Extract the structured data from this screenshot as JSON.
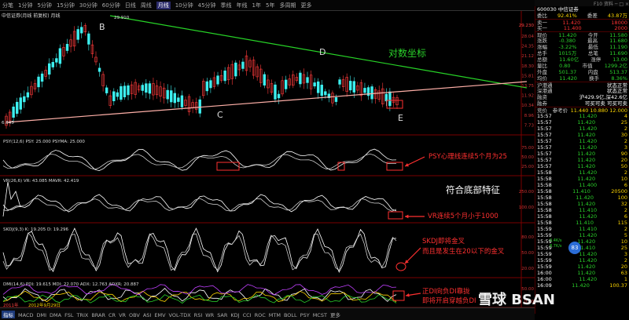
{
  "toolbar": {
    "period_tabs": [
      "分笔",
      "1分钟",
      "5分钟",
      "15分钟",
      "30分钟",
      "60分钟",
      "日线",
      "周线",
      "月线",
      "10分钟",
      "45分钟",
      "季线",
      "年线",
      "1年",
      "5年",
      "多周期",
      "更多"
    ],
    "active_tab": "月线"
  },
  "titlebar": {
    "text": "F10  资料  ─ □ ×"
  },
  "chart": {
    "title": "中信证券(月线 前复权) 月线",
    "high_label": "29.910",
    "low_label": "6.645",
    "right_top_price": "29.230",
    "y_labels": [
      "28.04",
      "24.35",
      "21.12",
      "18.30",
      "15.81",
      "13.75",
      "11.92",
      "10.34",
      "8.96",
      "7.73"
    ],
    "overlay_text": "对数坐标",
    "point_labels": {
      "B": "B",
      "C": "C",
      "D": "D",
      "E": "E"
    },
    "psy_label": "PSY(12,6) PSY: 25.000  PSYMA: 25.000",
    "psy_y": [
      "75.00",
      "50.00",
      "25.00"
    ],
    "psy_note": "PSY心理线连续5个月为25",
    "vr_label": "VR(26,6) VR: 43.085  MAVR: 42.419",
    "vr_y": [
      "250.00",
      "100.00"
    ],
    "vr_note": "VR连续5个月小于1000",
    "bottom_signal_note": "符合底部特征",
    "skdj_label": "SKDJ(9,3) K: 19.205  D: 19.296",
    "skdj_y": [
      "80.00",
      "50.00",
      "20.00"
    ],
    "skdj_note1": "SKDJ即将金叉",
    "skdj_note2": "而且是发生在20以下的金叉",
    "dmi_label": "DMI(14,6) PDI: 19.615  MDI: 22.070  ADX: 12.763  ADXR: 20.887",
    "dmi_y": [
      "50.00",
      "0.00"
    ],
    "dmi_note1": "正DI向负DI靠拢",
    "dmi_note2": "即将开启穿越负DI",
    "x_labels": [
      "2011年",
      "2012年9月29日"
    ]
  },
  "quote": {
    "code_name": "600030 中信证券",
    "rows": [
      {
        "k1": "委比",
        "v1": "92.41%",
        "k2": "委差",
        "v2": "43.87万"
      },
      {
        "k1": "卖一",
        "v1": "11.420",
        "k2": "",
        "v2": "18000"
      },
      {
        "k1": "买一",
        "v1": "11.400",
        "k2": "",
        "v2": "2000"
      }
    ],
    "stats": [
      {
        "k1": "现价",
        "v1": "11.420",
        "k2": "今开",
        "v2": "11.580"
      },
      {
        "k1": "涨跌",
        "v1": "-0.380",
        "k2": "最高",
        "v2": "11.680"
      },
      {
        "k1": "涨幅",
        "v1": "-3.22%",
        "k2": "最低",
        "v2": "11.190"
      },
      {
        "k1": "总手",
        "v1": "1015万",
        "k2": "总笔",
        "v2": "11.690"
      },
      {
        "k1": "总额",
        "v1": "11.60亿",
        "k2": "涨停",
        "v2": "13.00"
      },
      {
        "k1": "量比",
        "v1": "0.80",
        "k2": "市值",
        "v2": "1299.2亿"
      },
      {
        "k1": "外盘",
        "v1": "501.37",
        "k2": "内盘",
        "v2": "513.37"
      },
      {
        "k1": "均价",
        "v1": "11.420",
        "k2": "换手",
        "v2": "8.36%"
      }
    ],
    "status": [
      {
        "k": "沪港通",
        "v": "状态正常"
      },
      {
        "k": "深港通",
        "v": "状态正常"
      },
      {
        "k": "融资",
        "v": "沪429.9亿,深42.6亿"
      },
      {
        "k": "融券",
        "v": "可买可卖 可买可卖"
      }
    ],
    "ticks_header": {
      "k1": "竞价",
      "v1": "",
      "k2": "参考价",
      "v2": "11.440  10.880  12.000"
    },
    "ticks": [
      {
        "t": "15:57",
        "p": "11.420",
        "v": "4"
      },
      {
        "t": "15:57",
        "p": "11.420",
        "v": "25"
      },
      {
        "t": "15:57",
        "p": "11.420",
        "v": "2"
      },
      {
        "t": "15:57",
        "p": "11.420",
        "v": "30"
      },
      {
        "t": "15:57",
        "p": "11.420",
        "v": "2"
      },
      {
        "t": "15:57",
        "p": "11.420",
        "v": "3"
      },
      {
        "t": "15:57",
        "p": "11.420",
        "v": "90"
      },
      {
        "t": "15:57",
        "p": "11.420",
        "v": "20"
      },
      {
        "t": "15:57",
        "p": "11.420",
        "v": "50"
      },
      {
        "t": "15:58",
        "p": "11.420",
        "v": "2"
      },
      {
        "t": "15:58",
        "p": "11.420",
        "v": "10"
      },
      {
        "t": "15:58",
        "p": "11.400",
        "v": "6"
      },
      {
        "t": "15:58",
        "p": "11.410",
        "v": "20500"
      },
      {
        "t": "15:58",
        "p": "11.420",
        "v": "100"
      },
      {
        "t": "15:58",
        "p": "11.420",
        "v": "32"
      },
      {
        "t": "15:58",
        "p": "11.410",
        "v": "2"
      },
      {
        "t": "15:58",
        "p": "11.420",
        "v": "6"
      },
      {
        "t": "15:58",
        "p": "11.410",
        "v": "115"
      },
      {
        "t": "15:59",
        "p": "11.410",
        "v": "2"
      },
      {
        "t": "15:59",
        "p": "11.420",
        "v": "5"
      },
      {
        "t": "15:59",
        "p": "11.420",
        "v": "10"
      },
      {
        "t": "15:59",
        "p": "11.410",
        "v": "25"
      },
      {
        "t": "15:59",
        "p": "11.420",
        "v": "3"
      },
      {
        "t": "15:59",
        "p": "11.420",
        "v": "2"
      },
      {
        "t": "15:59",
        "p": "11.420",
        "v": "20"
      },
      {
        "t": "16:00",
        "p": "11.420",
        "v": "63"
      },
      {
        "t": "16:00",
        "p": "11.420",
        "v": "1"
      },
      {
        "t": "16:09",
        "p": "11.420",
        "v": "100.37"
      }
    ],
    "badge": "83",
    "speed1": "0.4K/s",
    "speed2": "8.7K/s"
  },
  "bottom_tabs": [
    "指标",
    "MACD",
    "DMI",
    "DMA",
    "FSL",
    "TRIX",
    "BRAR",
    "CR",
    "VR",
    "OBV",
    "ASI",
    "EMV",
    "VOL-TDX",
    "RSI",
    "WR",
    "SAR",
    "KDJ",
    "CCI",
    "ROC",
    "MTM",
    "BOLL",
    "PSY",
    "MCST",
    "更多"
  ],
  "bottom_active": "指标",
  "watermark": "雪球 BSAN"
}
